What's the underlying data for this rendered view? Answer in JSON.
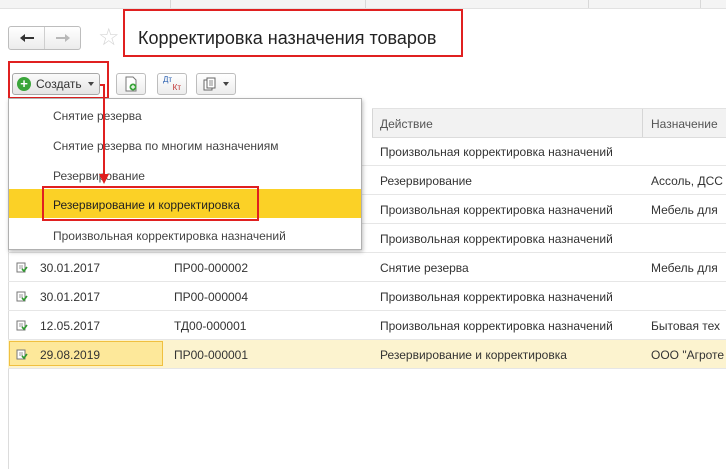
{
  "window": {
    "title": "Корректировка назначения товаров"
  },
  "toolbar": {
    "create_label": "Создать",
    "dt_kt_label_top": "Дт",
    "dt_kt_label_bottom": "Кт"
  },
  "create_menu": {
    "items": [
      {
        "label": "Снятие резерва"
      },
      {
        "label": "Снятие резерва по многим назначениям"
      },
      {
        "label": "Резервирование"
      },
      {
        "label": "Резервирование и корректировка",
        "highlighted": true
      },
      {
        "label": "Произвольная корректировка назначений"
      }
    ]
  },
  "table": {
    "columns": {
      "action": "Действие",
      "purpose": "Назначение"
    },
    "rows": [
      {
        "date": "",
        "number": "",
        "action": "Произвольная корректировка назначений",
        "purpose": ""
      },
      {
        "date": "",
        "number": "",
        "action": "Резервирование",
        "purpose": "Ассоль, ДСС"
      },
      {
        "date": "",
        "number": "",
        "action": "Произвольная корректировка назначений",
        "purpose": "Мебель для"
      },
      {
        "date": "",
        "number": "",
        "action": "Произвольная корректировка назначений",
        "purpose": ""
      },
      {
        "date": "30.01.2017",
        "number": "ПР00-000002",
        "action": "Снятие резерва",
        "purpose": "Мебель для"
      },
      {
        "date": "30.01.2017",
        "number": "ПР00-000004",
        "action": "Произвольная корректировка назначений",
        "purpose": ""
      },
      {
        "date": "12.05.2017",
        "number": "ТД00-000001",
        "action": "Произвольная корректировка назначений",
        "purpose": "Бытовая тех"
      },
      {
        "date": "29.08.2019",
        "number": "ПР00-000001",
        "action": "Резервирование и корректировка",
        "purpose": "ООО \"Агроте",
        "selected": true
      }
    ]
  },
  "colors": {
    "highlight_red": "#e02020",
    "menu_highlight": "#fbd126",
    "selected_row": "#fcf3cf",
    "create_icon": "#3aa53a"
  },
  "icons": [
    "back-arrow-icon",
    "forward-arrow-icon",
    "favorite-star-icon",
    "plus-circle-icon",
    "new-document-icon",
    "dt-kt-icon",
    "report-icon",
    "document-posted-icon"
  ]
}
